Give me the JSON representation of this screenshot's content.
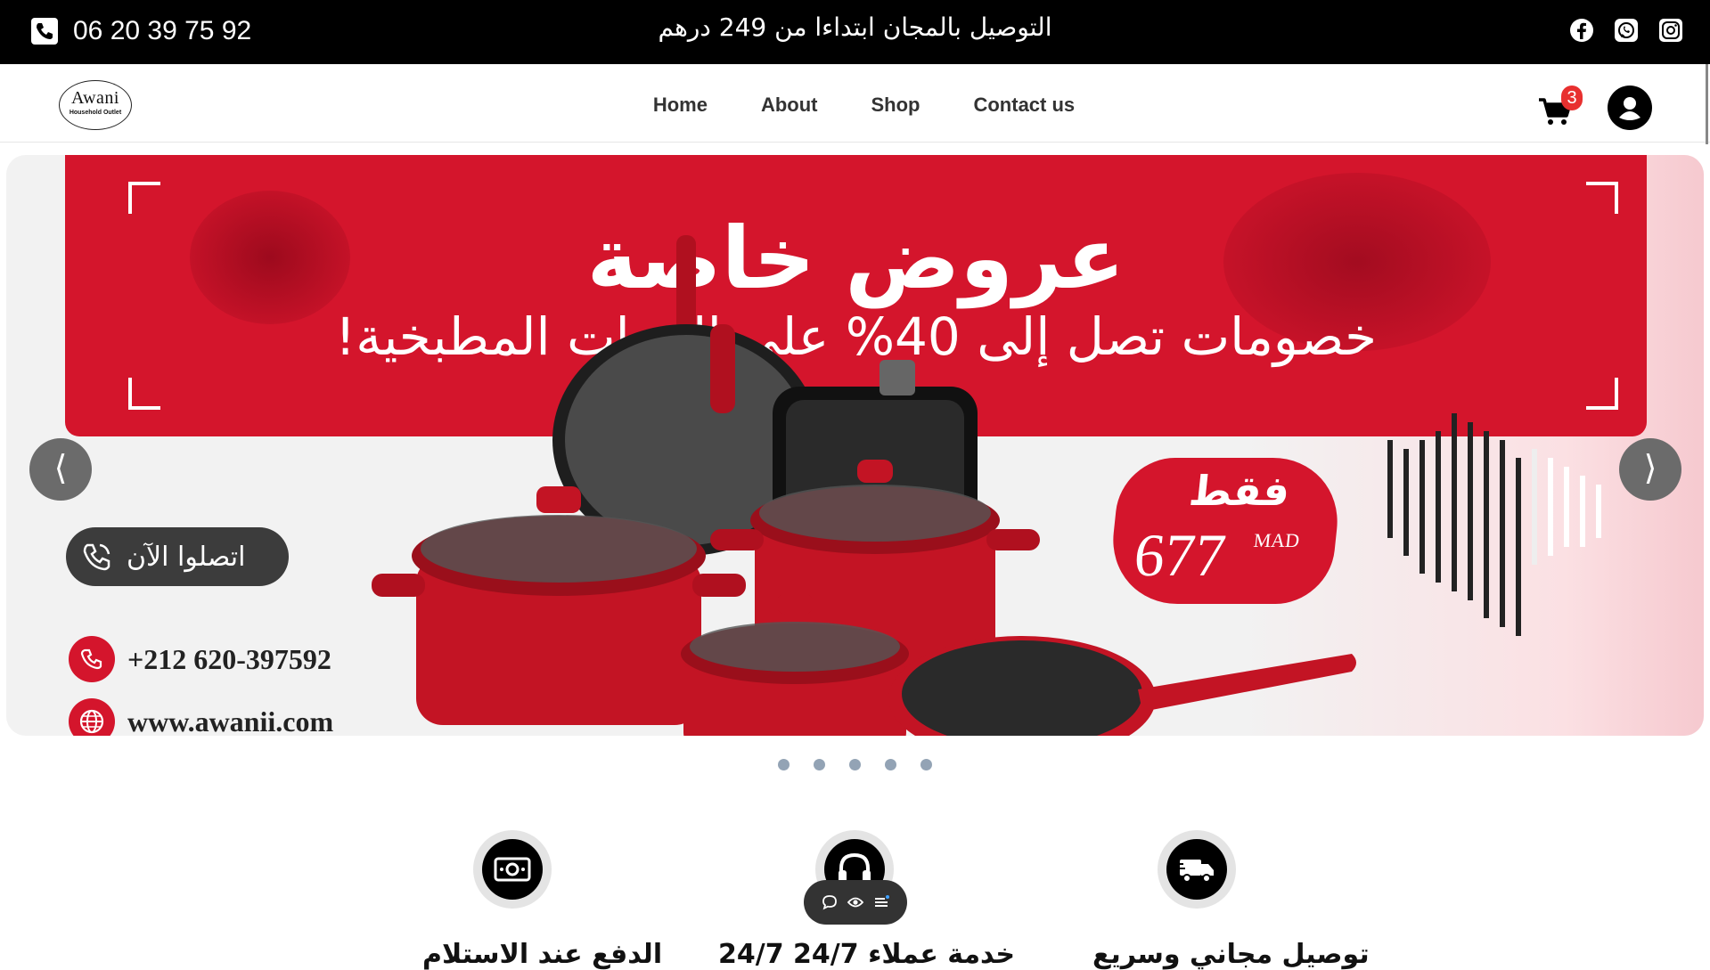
{
  "topbar": {
    "phone": "06 20 39 75 92",
    "promo": "التوصيل بالمجان ابتداءا من 249 درهم",
    "socials": [
      {
        "icon": "facebook-icon"
      },
      {
        "icon": "whatsapp-icon"
      },
      {
        "icon": "instagram-icon"
      }
    ]
  },
  "header": {
    "logo_title": "Awani",
    "logo_subtitle": "Household Outlet",
    "nav": [
      "Home",
      "About",
      "Shop",
      "Contact us"
    ],
    "cart_count": "3"
  },
  "slider": {
    "headline": "عروض خاصة",
    "subline": "خصومات تصل إلى 40% على الأدوات المطبخية!",
    "contact_button": "اتصلوا الآن",
    "phone": "+212 620-397592",
    "website": "www.awanii.com",
    "price_label": "فقط",
    "price_value": "677",
    "price_currency": "MAD",
    "prev_arrow": "⟨",
    "next_arrow": "⟩",
    "slide_count": 5,
    "accent_color": "#d4152c"
  },
  "features": [
    {
      "icon": "cash-icon",
      "label": "الدفع عند الاستلام"
    },
    {
      "icon": "headset-icon",
      "label": "خدمة عملاء 24/7 24/7"
    },
    {
      "icon": "delivery-truck-icon",
      "label": "توصيل مجاني وسريع"
    }
  ],
  "floating_toolbar": [
    "chat-icon",
    "eye-icon",
    "menu-icon"
  ]
}
